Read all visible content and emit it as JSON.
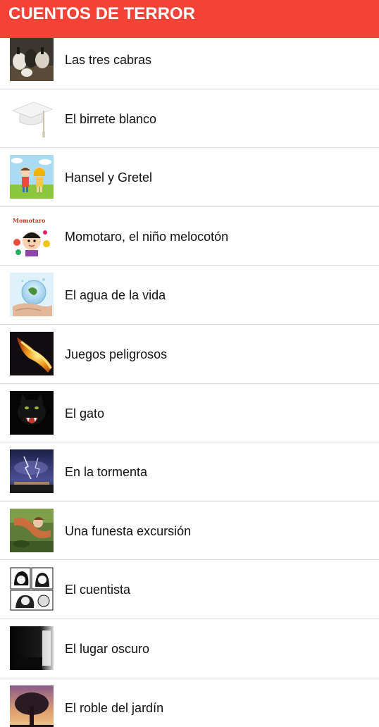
{
  "header": {
    "title": "CUENTOS DE TERROR",
    "color": "#f44336"
  },
  "stories": [
    {
      "title": "Las tres cabras",
      "thumbnail": "goats-image"
    },
    {
      "title": "El birrete blanco",
      "thumbnail": "graduation-cap-image"
    },
    {
      "title": "Hansel y Gretel",
      "thumbnail": "children-cartoon-image"
    },
    {
      "title": "Momotaro, el niño melocotón",
      "thumbnail": "momotaro-book-cover-image"
    },
    {
      "title": "El agua de la vida",
      "thumbnail": "water-globe-hands-image"
    },
    {
      "title": "Juegos peligrosos",
      "thumbnail": "fire-image"
    },
    {
      "title": "El gato",
      "thumbnail": "black-cat-image"
    },
    {
      "title": "En la tormenta",
      "thumbnail": "lightning-storm-image"
    },
    {
      "title": "Una funesta excursión",
      "thumbnail": "forest-excursion-image"
    },
    {
      "title": "El cuentista",
      "thumbnail": "manga-drawing-image"
    },
    {
      "title": "El lugar oscuro",
      "thumbnail": "dark-room-image"
    },
    {
      "title": "El roble del jardín",
      "thumbnail": "oak-tree-sunset-image"
    }
  ]
}
